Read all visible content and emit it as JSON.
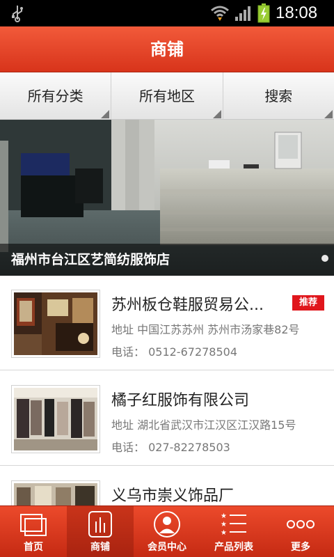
{
  "status_bar": {
    "time": "18:08",
    "icons": [
      "usb-icon",
      "wifi-icon",
      "signal-icon",
      "battery-charging-icon"
    ]
  },
  "header": {
    "title": "商铺"
  },
  "filters": [
    {
      "label": "所有分类"
    },
    {
      "label": "所有地区"
    },
    {
      "label": "搜索"
    }
  ],
  "banner": {
    "caption": "福州市台江区艺简纺服饰店"
  },
  "shops": [
    {
      "name": "苏州板仓鞋服贸易公...",
      "badge": "推荐",
      "address": "地址  中国江苏苏州 苏州市汤家巷82号",
      "phone": "电话：  0512-67278504"
    },
    {
      "name": "橘子红服饰有限公司",
      "badge": "",
      "address": "地址  湖北省武汉市江汉区江汉路15号",
      "phone": "电话：  027-82278503"
    },
    {
      "name": "义乌市崇义饰品厂",
      "badge": "",
      "address": "",
      "phone": ""
    }
  ],
  "bottom_nav": [
    {
      "label": "首页",
      "icon": "home-icon"
    },
    {
      "label": "商铺",
      "icon": "shops-icon",
      "active": true
    },
    {
      "label": "会员中心",
      "icon": "member-icon"
    },
    {
      "label": "产品列表",
      "icon": "product-list-icon"
    },
    {
      "label": "更多",
      "icon": "more-icon"
    }
  ],
  "colors": {
    "accent": "#e0411f",
    "badge": "#e0161c",
    "text_secondary": "#777777"
  }
}
